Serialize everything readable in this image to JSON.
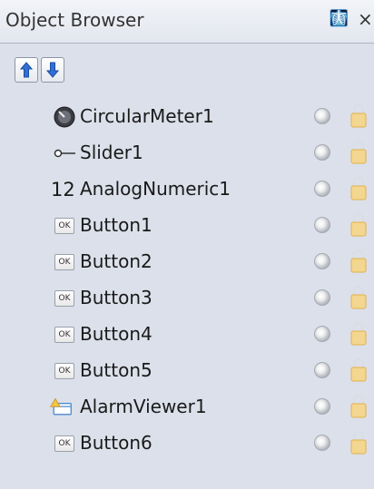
{
  "panel": {
    "title": "Object Browser",
    "pin_icon": "pin-icon",
    "close_icon": "close-icon"
  },
  "toolbar": {
    "move_up_icon": "arrow-up-icon",
    "move_down_icon": "arrow-down-icon"
  },
  "items": [
    {
      "label": "CircularMeter1",
      "icon": "circular-meter-icon"
    },
    {
      "label": "Slider1",
      "icon": "slider-icon"
    },
    {
      "label": "AnalogNumeric1",
      "icon": "numeric-icon",
      "icon_text": "12"
    },
    {
      "label": "Button1",
      "icon": "ok-button-icon",
      "icon_text": "OK"
    },
    {
      "label": "Button2",
      "icon": "ok-button-icon",
      "icon_text": "OK"
    },
    {
      "label": "Button3",
      "icon": "ok-button-icon",
      "icon_text": "OK"
    },
    {
      "label": "Button4",
      "icon": "ok-button-icon",
      "icon_text": "OK"
    },
    {
      "label": "Button5",
      "icon": "ok-button-icon",
      "icon_text": "OK"
    },
    {
      "label": "AlarmViewer1",
      "icon": "alarm-viewer-icon"
    },
    {
      "label": "Button6",
      "icon": "ok-button-icon",
      "icon_text": "OK"
    }
  ],
  "colors": {
    "panel_bg": "#dbe0ea",
    "arrow_blue": "#2f6fd6",
    "lock_gold": "#e3b24a"
  }
}
